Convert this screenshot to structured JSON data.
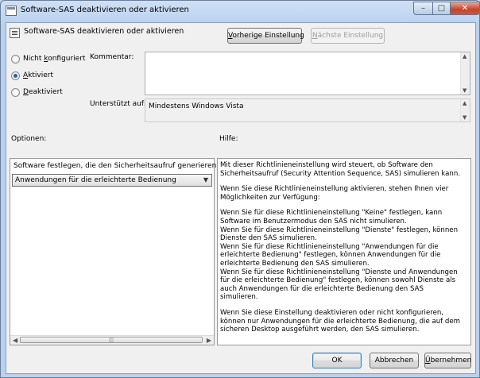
{
  "window": {
    "title": "Software-SAS deaktivieren oder aktivieren",
    "controls": {
      "minimize": "–",
      "maximize": "□",
      "close": "✕"
    }
  },
  "policy": {
    "title": "Software-SAS deaktivieren oder aktivieren",
    "prev_button": "Vorherige Einstellung",
    "next_button": "Nächste Einstellung"
  },
  "state": {
    "options": [
      {
        "label": "Nicht konfiguriert",
        "checked": false
      },
      {
        "label": "Aktiviert",
        "checked": true
      },
      {
        "label": "Deaktiviert",
        "checked": false
      }
    ]
  },
  "comment": {
    "label": "Kommentar:",
    "value": ""
  },
  "supported": {
    "label": "Unterstützt auf:",
    "value": "Mindestens Windows Vista"
  },
  "options_section": {
    "label": "Optionen:",
    "field_label": "Software festlegen, die den Sicherheitsaufruf generieren darf",
    "selected": "Anwendungen für die erleichterte Bedienung"
  },
  "help": {
    "label": "Hilfe:",
    "paragraphs": [
      "Mit dieser Richtlinieneinstellung wird steuert, ob Software den Sicherheitsaufruf (Security Attention Sequence, SAS) simulieren kann.",
      "Wenn Sie diese Richtlinieneinstellung aktivieren, stehen Ihnen vier Möglichkeiten zur Verfügung:",
      "Wenn Sie für diese Richtlinieneinstellung \"Keine\" festlegen, kann Software im Benutzermodus den SAS nicht simulieren.",
      "Wenn Sie für diese Richtlinieneinstellung \"Dienste\" festlegen, können Dienste den SAS simulieren.",
      "Wenn Sie für diese Richtlinieneinstellung \"Anwendungen für die erleichterte Bedienung\" festlegen, können Anwendungen für die erleichterte Bedienung den SAS simulieren.",
      "Wenn Sie für diese Richtlinieneinstellung \"Dienste und Anwendungen für die erleichterte Bedienung\" festlegen, können sowohl Dienste als auch Anwendungen für die erleichterte Bedienung den SAS simulieren.",
      "Wenn Sie diese Einstellung deaktivieren oder nicht konfigurieren, können nur Anwendungen für die erleichterte Bedienung, die auf dem sicheren Desktop ausgeführt werden, den SAS simulieren."
    ]
  },
  "footer": {
    "ok": "OK",
    "cancel": "Abbrechen",
    "apply": "Übernehmen"
  }
}
